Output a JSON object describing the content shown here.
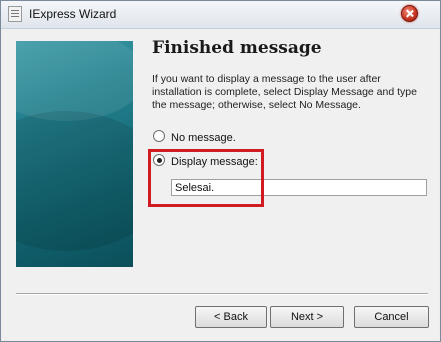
{
  "window": {
    "title": "IExpress Wizard",
    "icon": "wizard-app-icon",
    "close_icon": "close-icon"
  },
  "page": {
    "heading": "Finished message",
    "description": "If you want to display a message to the user after installation is complete, select Display Message and type the message; otherwise, select No Message."
  },
  "options": {
    "no_message": {
      "label": "No message.",
      "selected": false
    },
    "display_message": {
      "label": "Display message:",
      "selected": true
    }
  },
  "message_input": {
    "value": "Selesai."
  },
  "buttons": {
    "back": "< Back",
    "next": "Next >",
    "cancel": "Cancel"
  },
  "highlight": {
    "color": "#d01b22"
  }
}
